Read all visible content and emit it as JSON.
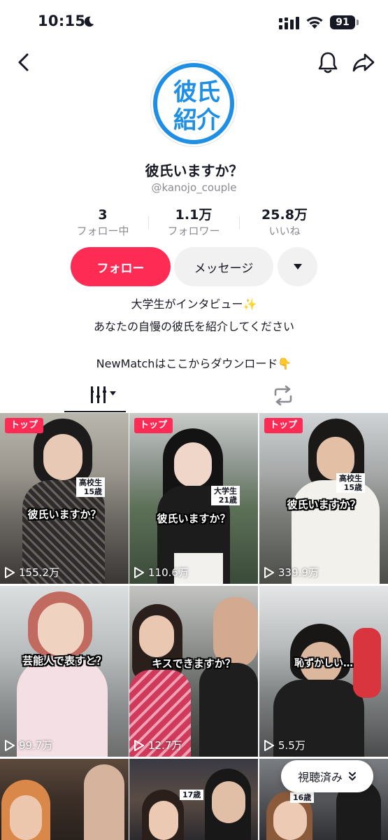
{
  "status_bar": {
    "time": "10:15",
    "battery": "91"
  },
  "icons": {
    "back": "chevron-left-icon",
    "notifications": "bell-icon",
    "share": "share-arrow-icon",
    "moon": "moon-icon",
    "signal": "signal-icon",
    "wifi": "wifi-icon"
  },
  "profile": {
    "avatar_line_1": "彼氏",
    "avatar_line_2": "紹介",
    "name": "彼氏いますか？",
    "handle": "@kanojo_couple"
  },
  "stats": [
    {
      "value": "3",
      "label": "フォロー中"
    },
    {
      "value": "1.1万",
      "label": "フォロワー"
    },
    {
      "value": "25.8万",
      "label": "いいね"
    }
  ],
  "actions": {
    "follow": "フォロー",
    "message": "メッセージ"
  },
  "bio": {
    "line1": "大学生がインタビュー✨",
    "line2": "あなたの自慢の彼氏を紹介してください",
    "link_line": "NewMatchはここからダウンロード👇"
  },
  "colors": {
    "accent": "#fe2c55",
    "avatar_blue": "#1f8fe5",
    "text_secondary": "#8a8b91"
  },
  "videos": [
    {
      "badge": "トップ",
      "caption": "彼氏いますか？",
      "age_line1": "高校生",
      "age_line2": "15歳",
      "views": "155.2万"
    },
    {
      "badge": "トップ",
      "caption": "彼氏いますか？",
      "age_line1": "大学生",
      "age_line2": "21歳",
      "views": "110.6万"
    },
    {
      "badge": "トップ",
      "caption": "彼氏いますか？",
      "age_line1": "高校生",
      "age_line2": "15歳",
      "views": "339.9万"
    },
    {
      "caption": "芸能人で表すと？",
      "views": "99.7万"
    },
    {
      "caption": "キスできますか？",
      "views": "12.7万"
    },
    {
      "caption": "恥ずかしい…",
      "views": "5.5万"
    },
    {
      "caption": ""
    },
    {
      "age_line2": "17歳"
    },
    {
      "age_line2": "16歳"
    }
  ],
  "watched_button": "視聴済み"
}
